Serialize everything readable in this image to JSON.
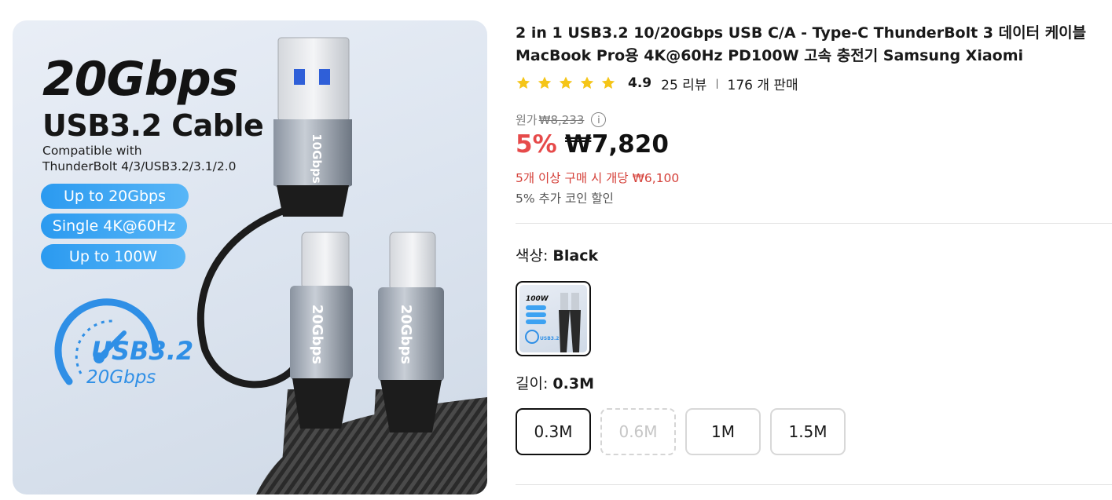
{
  "product_image": {
    "headline": "20Gbps",
    "subheadline": "USB3.2 Cable",
    "compat_line1": "Compatible with",
    "compat_line2": "ThunderBolt 4/3/USB3.2/3.1/2.0",
    "pills": [
      "Up to 20Gbps",
      "Single 4K@60Hz",
      "Up to 100W"
    ],
    "gauge_label": "USB3.2",
    "gauge_speed": "20Gbps",
    "connector_labels": [
      "10Gbps",
      "20Gbps",
      "20Gbps"
    ]
  },
  "product": {
    "title_line1": "2 in 1 USB3.2 10/20Gbps USB C/A - Type-C ThunderBolt 3 데이터 케이블",
    "title_line2": "MacBook Pro용 4K@60Hz PD100W 고속 충전기 Samsung Xiaomi",
    "star_count": 5,
    "star_color": "#f5c518",
    "rating": "4.9",
    "reviews": "25 리뷰",
    "separator": "|",
    "sold": "176 개 판매"
  },
  "pricing": {
    "original_label": "원가",
    "original_price": "₩8,233",
    "info_icon": "i",
    "discount": "5%",
    "price": "₩7,820",
    "bulk_deal": "5개 이상 구매 시 개당 ₩6,100",
    "coin_deal": "5% 추가 코인 할인",
    "discount_color": "#e64a4a"
  },
  "options": {
    "color_label": "색상: ",
    "color_value": "Black",
    "length_label": "길이: ",
    "length_value": "0.3M",
    "lengths": [
      {
        "label": "0.3M",
        "state": "selected"
      },
      {
        "label": "0.6M",
        "state": "disabled"
      },
      {
        "label": "1M",
        "state": "normal"
      },
      {
        "label": "1.5M",
        "state": "normal"
      }
    ]
  }
}
